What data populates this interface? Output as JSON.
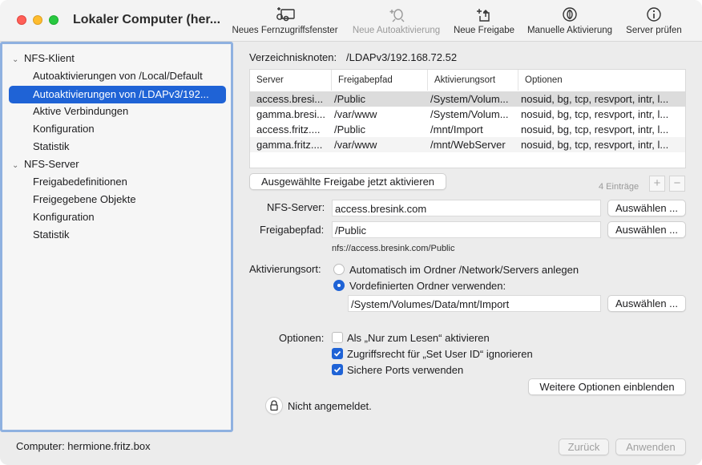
{
  "window": {
    "title": "Lokaler Computer (her..."
  },
  "toolbar": {
    "new_remote": "Neues Fernzugriffsfenster",
    "new_automount": "Neue Autoaktivierung",
    "new_share": "Neue Freigabe",
    "manual_mount": "Manuelle Aktivierung",
    "check_server": "Server prüfen"
  },
  "sidebar": {
    "client_group": "NFS-Klient",
    "client_items": [
      "Autoaktivierungen von /Local/Default",
      "Autoaktivierungen von /LDAPv3/192...",
      "Aktive Verbindungen",
      "Konfiguration",
      "Statistik"
    ],
    "server_group": "NFS-Server",
    "server_items": [
      "Freigabedefinitionen",
      "Freigegebene Objekte",
      "Konfiguration",
      "Statistik"
    ]
  },
  "footer": {
    "computer": "Computer: hermione.fritz.box",
    "revert": "Zurück",
    "apply": "Anwenden"
  },
  "main": {
    "node_label": "Verzeichnisknoten:",
    "node_value": "/LDAPv3/192.168.72.52",
    "columns": [
      "Server",
      "Freigabepfad",
      "Aktivierungsort",
      "Optionen"
    ],
    "rows": [
      [
        "access.bresi...",
        "/Public",
        "/System/Volum...",
        "nosuid, bg, tcp, resvport, intr, l..."
      ],
      [
        "gamma.bresi...",
        "/var/www",
        "/System/Volum...",
        "nosuid, bg, tcp, resvport, intr, l..."
      ],
      [
        "access.fritz....",
        "/Public",
        "/mnt/Import",
        "nosuid, bg, tcp, resvport, intr, l..."
      ],
      [
        "gamma.fritz....",
        "/var/www",
        "/mnt/WebServer",
        "nosuid, bg, tcp, resvport, intr, l..."
      ]
    ],
    "activate_button": "Ausgewählte Freigabe jetzt aktivieren",
    "entry_count": "4 Einträge",
    "add": "+",
    "remove": "−",
    "server_label": "NFS-Server:",
    "server_value": "access.bresink.com",
    "choose": "Auswählen ...",
    "path_label": "Freigabepfad:",
    "path_value": "/Public",
    "url": "nfs://access.bresink.com/Public",
    "mount_label": "Aktivierungsort:",
    "radio_auto": "Automatisch im Ordner /Network/Servers anlegen",
    "radio_predef": "Vordefinierten Ordner verwenden:",
    "mount_value": "/System/Volumes/Data/mnt/Import",
    "options_label": "Optionen:",
    "opt_readonly": "Als „Nur zum Lesen“ aktivieren",
    "opt_setuid": "Zugriffsrecht für „Set User ID“ ignorieren",
    "opt_ports": "Sichere Ports verwenden",
    "more_options": "Weitere Optionen einblenden",
    "lock_text": "Nicht angemeldet."
  }
}
